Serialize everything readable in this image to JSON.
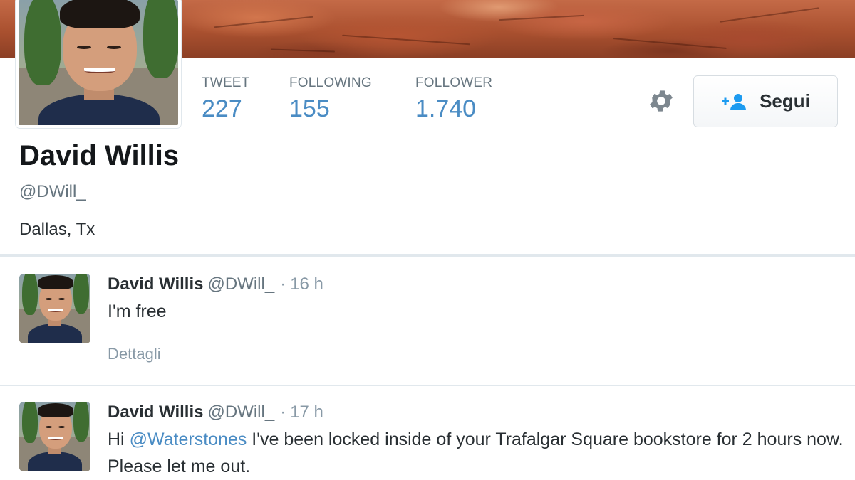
{
  "profile": {
    "name": "David Willis",
    "handle": "@DWill_",
    "location": "Dallas, Tx"
  },
  "stats": [
    {
      "label": "TWEET",
      "value": "227"
    },
    {
      "label": "FOLLOWING",
      "value": "155"
    },
    {
      "label": "FOLLOWER",
      "value": "1.740"
    }
  ],
  "actions": {
    "follow_label": "Segui",
    "settings_icon": "gear-icon",
    "follow_icon": "add-user-icon"
  },
  "tweets": [
    {
      "name": "David Willis",
      "handle": "@DWill_",
      "separator": "·",
      "time": "16 h",
      "text": "I'm free",
      "details_label": "Dettagli"
    },
    {
      "name": "David Willis",
      "handle": "@DWill_",
      "separator": "·",
      "time": "17 h",
      "text_before": "Hi ",
      "mention": "@Waterstones",
      "text_after": " I've been locked inside of your Trafalgar Square bookstore for 2 hours now.  Please let me out."
    }
  ],
  "colors": {
    "link": "#4a8cc4",
    "muted": "#66757f",
    "text": "#292f33",
    "follow_icon": "#1d9bf0"
  }
}
